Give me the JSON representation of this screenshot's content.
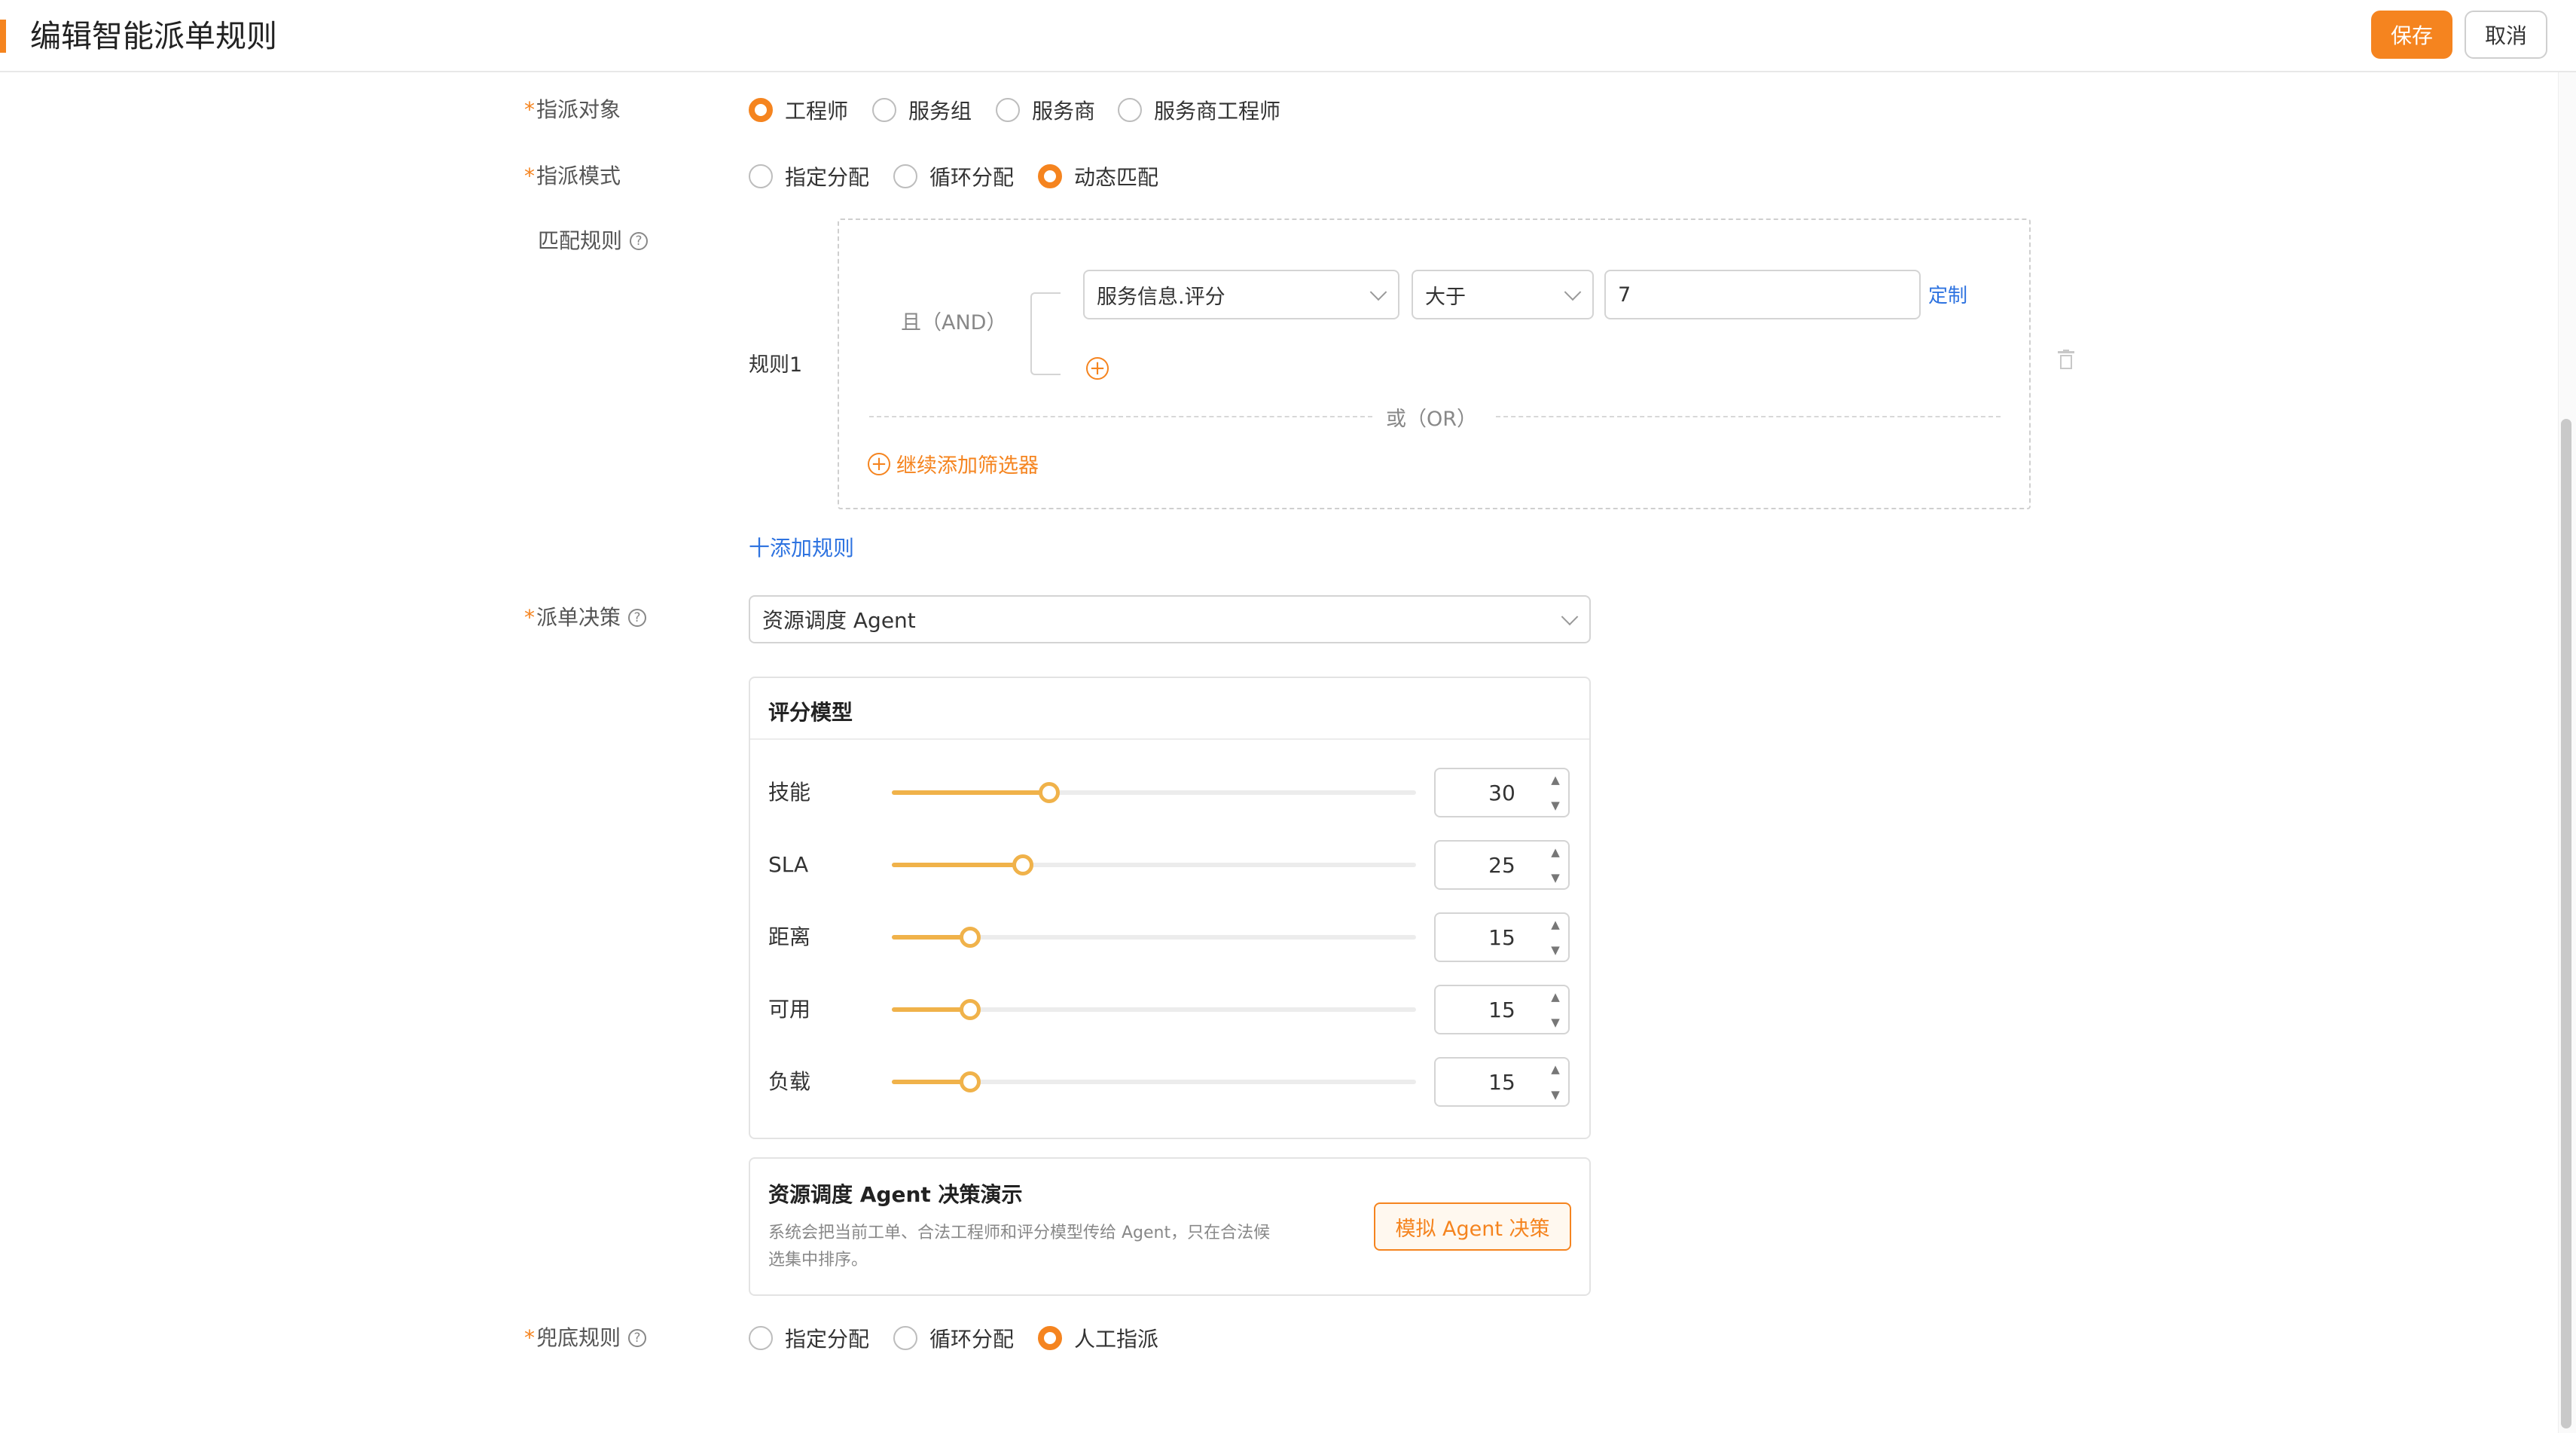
{
  "header": {
    "title": "编辑智能派单规则",
    "save_label": "保存",
    "cancel_label": "取消"
  },
  "assign_target": {
    "label": "指派对象",
    "options": [
      "工程师",
      "服务组",
      "服务商",
      "服务商工程师"
    ],
    "selected": 0
  },
  "assign_mode": {
    "label": "指派模式",
    "options": [
      "指定分配",
      "循环分配",
      "动态匹配"
    ],
    "selected": 2
  },
  "match_rules": {
    "label": "匹配规则",
    "rule_name": "规则1",
    "and_label": "且（AND）",
    "or_label": "或（OR）",
    "condition": {
      "field": "服务信息.评分",
      "operator": "大于",
      "value": "7",
      "custom_label": "定制"
    },
    "add_filter_label": "继续添加筛选器",
    "add_rule_label": "十添加规则"
  },
  "decision": {
    "label": "派单决策",
    "selected": "资源调度 Agent"
  },
  "scoring_model": {
    "title": "评分模型",
    "max": 100,
    "items": [
      {
        "label": "技能",
        "value": 30
      },
      {
        "label": "SLA",
        "value": 25
      },
      {
        "label": "距离",
        "value": 15
      },
      {
        "label": "可用",
        "value": 15
      },
      {
        "label": "负载",
        "value": 15
      }
    ]
  },
  "demo": {
    "title": "资源调度 Agent 决策演示",
    "desc_line1": "系统会把当前工单、合法工程师和评分模型传给 Agent，只在合法候",
    "desc_line2": "选集中排序。",
    "button_label": "模拟 Agent 决策"
  },
  "fallback": {
    "label": "兜底规则",
    "options": [
      "指定分配",
      "循环分配",
      "人工指派"
    ],
    "selected": 2
  },
  "colors": {
    "accent": "#f5841f",
    "slider": "#f0b24a",
    "link": "#2e73e0"
  }
}
